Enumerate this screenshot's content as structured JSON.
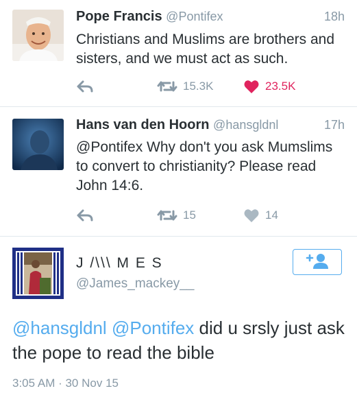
{
  "tweets": [
    {
      "name": "Pope Francis",
      "handle": "@Pontifex",
      "time": "18h",
      "text": "Christians and Muslims are brothers and sisters, and we must act as such.",
      "retweets": "15.3K",
      "likes": "23.5K",
      "liked": true
    },
    {
      "name": "Hans van den Hoorn",
      "handle": "@hansgldnl",
      "time": "17h",
      "text": "@Pontifex Why don't you ask Mumslims to convert to christianity? Please read John 14:6.",
      "retweets": "15",
      "likes": "14",
      "liked": false
    }
  ],
  "expanded": {
    "name": "J /\\\\\\ M E S",
    "handle": "@James_mackey__",
    "mention1": "@hansgldnl",
    "mention2": "@Pontifex",
    "text": " did u srsly just ask the pope to read the bible",
    "timestamp": "3:05 AM · 30 Nov 15"
  },
  "colors": {
    "accent": "#55acee",
    "like": "#e0245e",
    "muted": "#8899a6",
    "text": "#292f33",
    "divider": "#e1e8ed"
  },
  "icons": {
    "reply": "reply-icon",
    "retweet": "retweet-icon",
    "like": "heart-icon",
    "follow": "add-user-icon"
  }
}
